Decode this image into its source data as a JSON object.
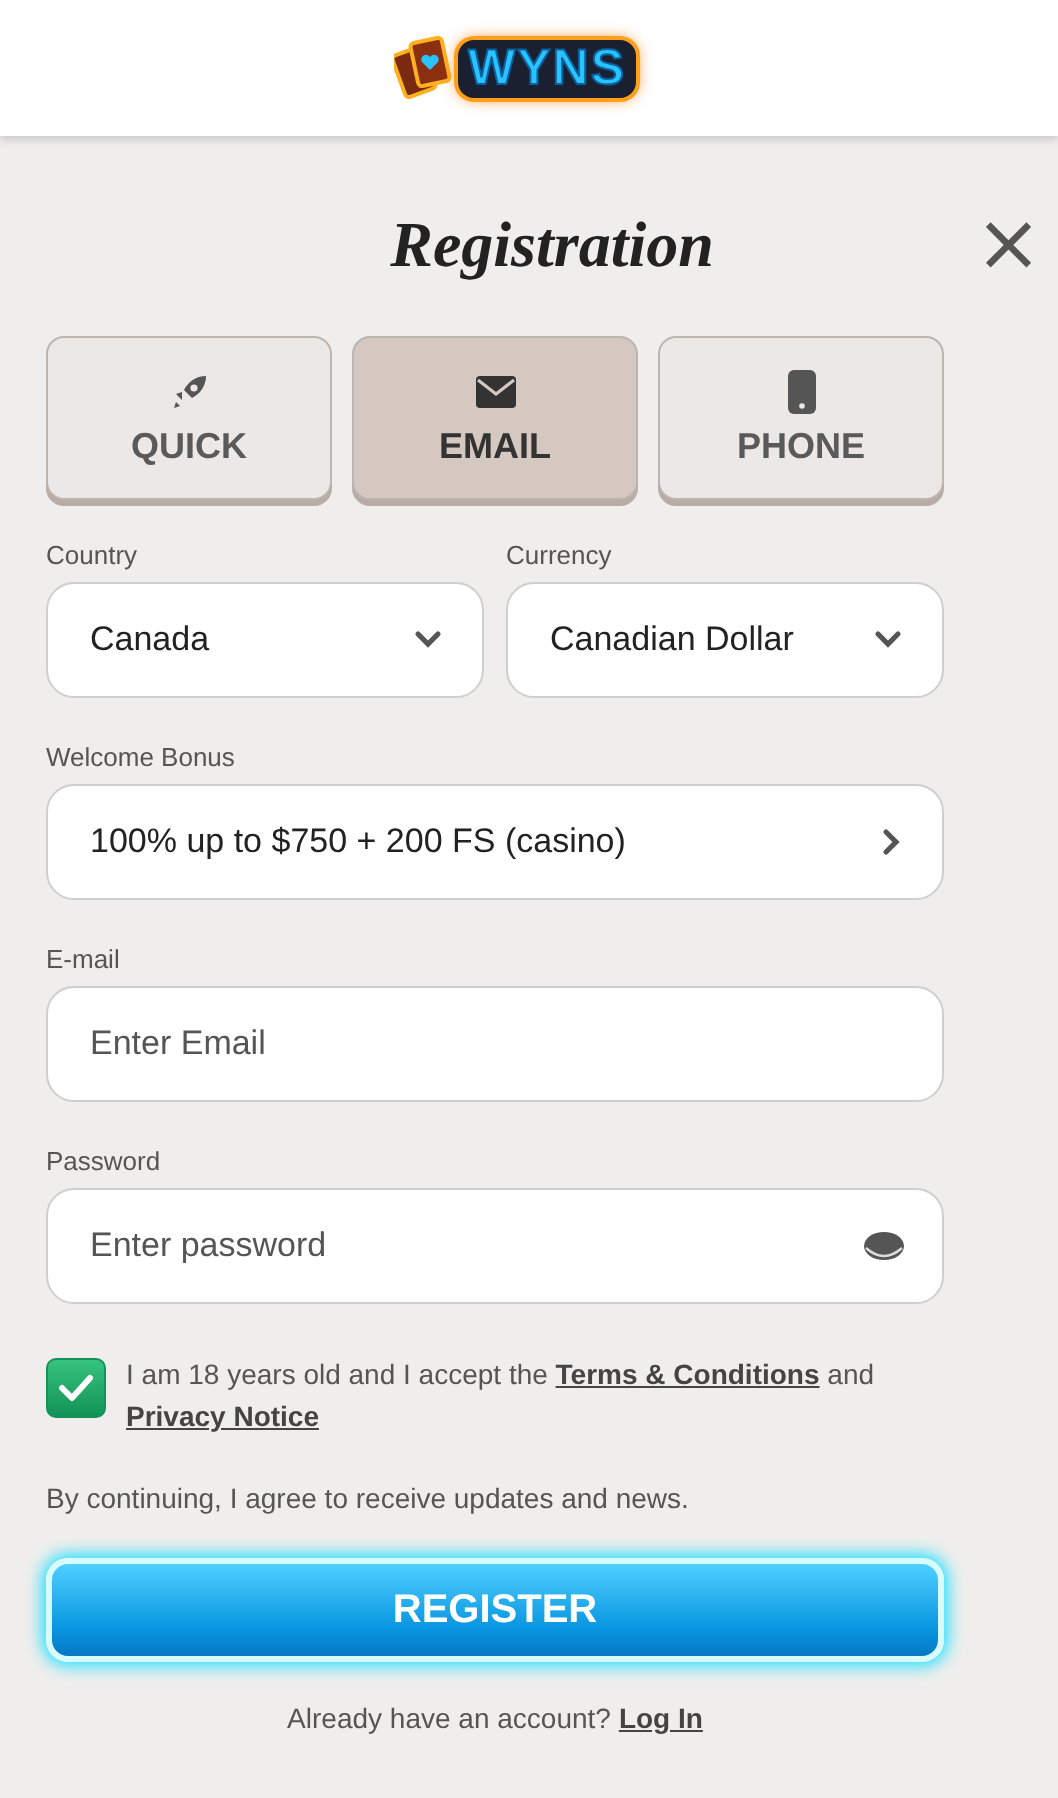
{
  "header": {
    "logo_text": "WYNS"
  },
  "title": "Registration",
  "close": "×",
  "tabs": [
    {
      "label": "QUICK",
      "kind": "rocket",
      "selected": false
    },
    {
      "label": "EMAIL",
      "kind": "envelope",
      "selected": true
    },
    {
      "label": "PHONE",
      "kind": "phone",
      "selected": false
    }
  ],
  "selects": [
    {
      "label": "Country",
      "value": "Canada"
    },
    {
      "label": "Currency",
      "value": "Canadian Dollar"
    }
  ],
  "bonus": {
    "label": "Welcome Bonus",
    "value": "100% up to $750 + 200 FS (casino)"
  },
  "fields": [
    {
      "label": "E-mail",
      "placeholder": "Enter Email",
      "kind": "email"
    },
    {
      "label": "Password",
      "placeholder": "Enter password",
      "kind": "password"
    }
  ],
  "consent": {
    "checked": true,
    "parts": [
      {
        "kind": "text",
        "text": "I am 18 years old and I accept the"
      },
      {
        "kind": "link",
        "text": "Terms & Conditions"
      },
      {
        "kind": "text",
        "text": "and"
      },
      {
        "kind": "link",
        "text": "Privacy Notice"
      }
    ]
  },
  "note": "By continuing, I agree to receive updates and news.",
  "register": "REGISTER",
  "footer": {
    "text": "Already have an account?",
    "link": "Log In"
  }
}
